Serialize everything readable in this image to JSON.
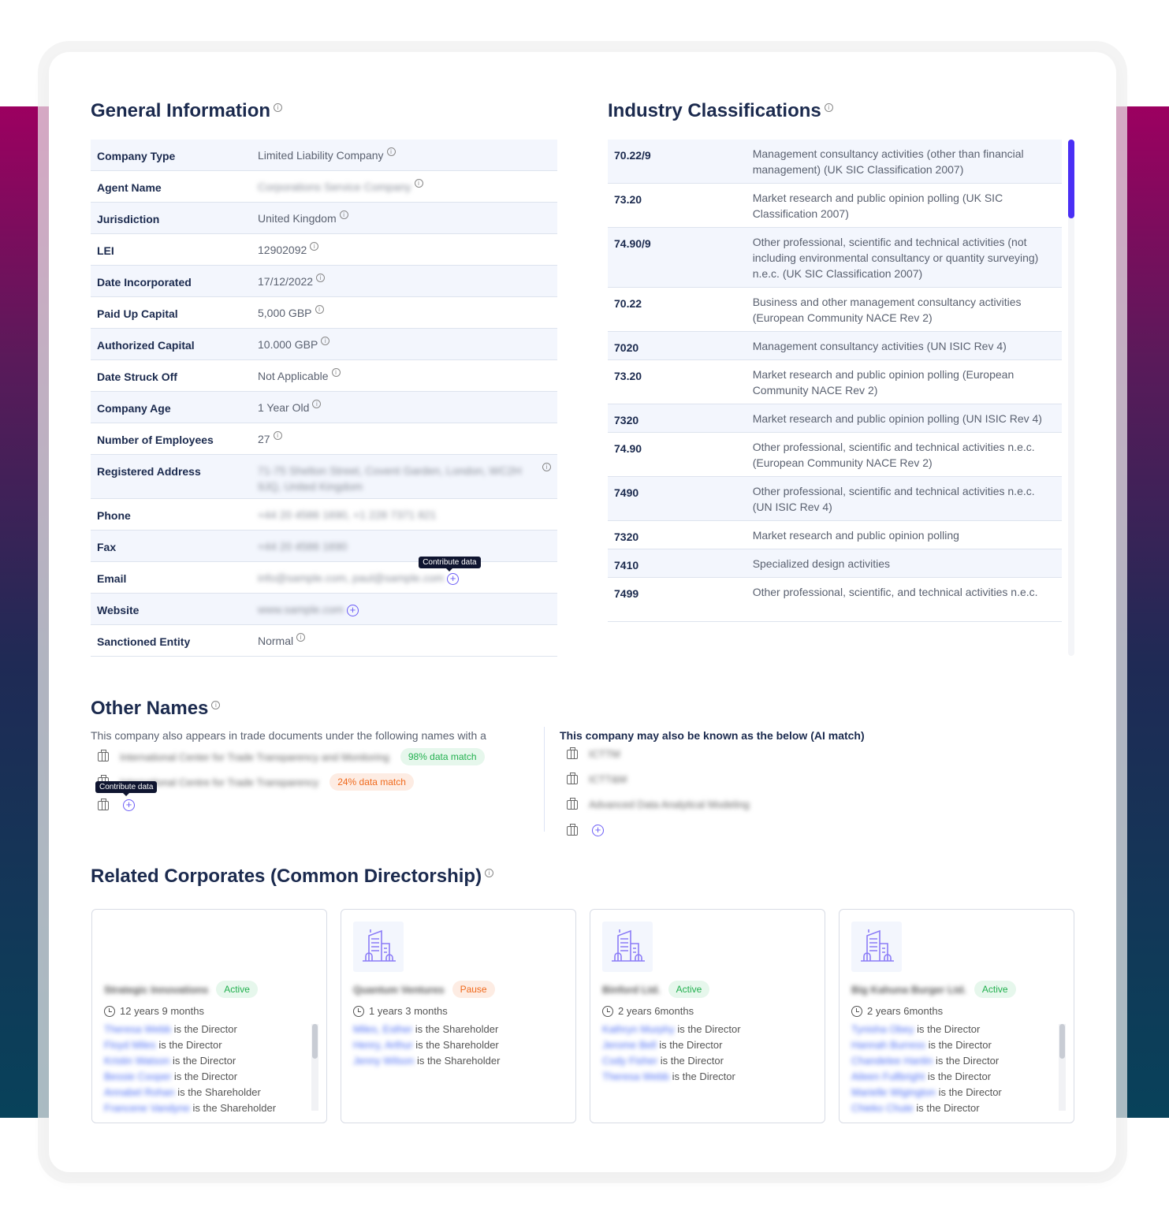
{
  "general": {
    "title": "General Information",
    "rows": [
      {
        "label": "Company Type",
        "value": "Limited Liability Company",
        "icon": "info"
      },
      {
        "label": "Agent Name",
        "value": "Corporations Service Company",
        "icon": "info",
        "blur": true
      },
      {
        "label": "Jurisdiction",
        "value": "United Kingdom",
        "icon": "info"
      },
      {
        "label": "LEI",
        "value": "12902092",
        "icon": "info"
      },
      {
        "label": "Date Incorporated",
        "value": "17/12/2022",
        "icon": "info"
      },
      {
        "label": "Paid Up Capital",
        "value": "5,000 GBP",
        "icon": "info"
      },
      {
        "label": "Authorized Capital",
        "value": "10.000 GBP",
        "icon": "info"
      },
      {
        "label": "Date Struck Off",
        "value": "Not Applicable",
        "icon": "info"
      },
      {
        "label": "Company Age",
        "value": "1 Year Old",
        "icon": "info"
      },
      {
        "label": "Number of Employees",
        "value": "27",
        "icon": "info"
      },
      {
        "label": "Registered Address",
        "value": "71-75 Shelton Street, Covent Garden, London, WC2H 9JQ, United Kingdom",
        "icon": "info-right",
        "blur": true,
        "tall": true
      },
      {
        "label": "Phone",
        "value": "+44 20 4586 1690, +1 228 7371 821",
        "blur": true
      },
      {
        "label": "Fax",
        "value": "+44 20 4586 1690",
        "blur": true
      },
      {
        "label": "Email",
        "value": "info@sample.com, paul@sample.com",
        "blur": true,
        "icon": "plus",
        "tooltip": "Contribute data"
      },
      {
        "label": "Website",
        "value": "www.sample.com",
        "blur": true,
        "icon": "plus"
      },
      {
        "label": "Sanctioned Entity",
        "value": "Normal",
        "icon": "info"
      }
    ]
  },
  "industry": {
    "title": "Industry Classifications",
    "rows": [
      {
        "code": "70.22/9",
        "desc": "Management consultancy activities (other than financial management) (UK SIC Classification 2007)"
      },
      {
        "code": "73.20",
        "desc": "Market research and public opinion polling (UK SIC Classification 2007)"
      },
      {
        "code": "74.90/9",
        "desc": "Other professional, scientific and technical activities (not including environmental consultancy or quantity surveying) n.e.c. (UK SIC Classification 2007)"
      },
      {
        "code": "70.22",
        "desc": "Business and other management consultancy activities (European Community NACE Rev 2)"
      },
      {
        "code": "7020",
        "desc": "Management consultancy activities (UN ISIC Rev 4)"
      },
      {
        "code": "73.20",
        "desc": "Market research and public opinion polling (European Community NACE Rev 2)"
      },
      {
        "code": "7320",
        "desc": "Market research and public opinion polling (UN ISIC Rev 4)"
      },
      {
        "code": "74.90",
        "desc": "Other professional, scientific and technical activities n.e.c. (European Community NACE Rev 2)"
      },
      {
        "code": "7490",
        "desc": "Other professional, scientific and technical activities n.e.c. (UN ISIC Rev 4)"
      },
      {
        "code": "7320",
        "desc": "Market research and public opinion polling"
      },
      {
        "code": "7410",
        "desc": "Specialized design activities"
      },
      {
        "code": "7499",
        "desc": "Other professional, scientific, and technical activities n.e.c."
      }
    ]
  },
  "other_names": {
    "title": "Other Names",
    "subtitle": "This company also appears in trade documents under the following names with a",
    "items": [
      {
        "name": "International Center for Trade Transparency and Monitoring",
        "match": "98% data match",
        "tone": "green"
      },
      {
        "name": "International Centre for Trade Transparency",
        "match": "24% data match",
        "tone": "orange"
      }
    ],
    "tooltip": "Contribute data",
    "ai_title": "This company may also be known as the below (AI match)",
    "ai_items": [
      "ICTTM",
      "ICTT&M",
      "Advanced Data Analytical Modeling"
    ]
  },
  "related": {
    "title": "Related Corporates (Common Directorship)",
    "cards": [
      {
        "name": "Strategic Innovations",
        "status": "Active",
        "tone": "green",
        "duration": "12 years 9 months",
        "icon": false,
        "scroll": true,
        "relations": [
          [
            "Theresa Webb",
            "is the Director"
          ],
          [
            "Floyd Miles",
            "is the Director"
          ],
          [
            "Kristin Watson",
            "is the Director"
          ],
          [
            "Bessie Cooper",
            "is the Director"
          ],
          [
            "Annabel Rohan",
            "is the Shareholder"
          ],
          [
            "Francene Vandyne",
            "is the Shareholder"
          ]
        ]
      },
      {
        "name": "Quantum Ventures",
        "status": "Pause",
        "tone": "orange",
        "duration": "1 years 3 months",
        "icon": true,
        "relations": [
          [
            "Miles, Esther",
            "is the Shareholder"
          ],
          [
            "Henry, Arthur",
            "is the Shareholder"
          ],
          [
            "Jenny Wilson",
            "is the Shareholder"
          ]
        ]
      },
      {
        "name": "Binford Ltd.",
        "status": "Active",
        "tone": "green",
        "duration": "2 years 6months",
        "icon": true,
        "relations": [
          [
            "Kathryn Murphy",
            "is the Director"
          ],
          [
            "Jerome Bell",
            "is the Director"
          ],
          [
            "Cody Fisher",
            "is the Director"
          ],
          [
            "Theresa Webb",
            "is the Director"
          ]
        ]
      },
      {
        "name": "Big Kahuna Burger Ltd.",
        "status": "Active",
        "tone": "green",
        "duration": "2 years 6months",
        "icon": true,
        "scroll": true,
        "relations": [
          [
            "Tynisha Obey",
            "is the Director"
          ],
          [
            "Hannah Burress",
            "is the Director"
          ],
          [
            "Chandelee Hanlin",
            "is the Director"
          ],
          [
            "Aileen Fullbright",
            "is the Director"
          ],
          [
            "Marielle Wigington",
            "is the Director"
          ],
          [
            "Chieko Chute",
            "is the Director"
          ]
        ]
      }
    ]
  },
  "colors": {
    "accent": "#6b5cf6",
    "scroll_thumb": "#4a2ff5",
    "title": "#1b2a4e",
    "active": "#22b04f",
    "pause": "#f06a1d"
  }
}
